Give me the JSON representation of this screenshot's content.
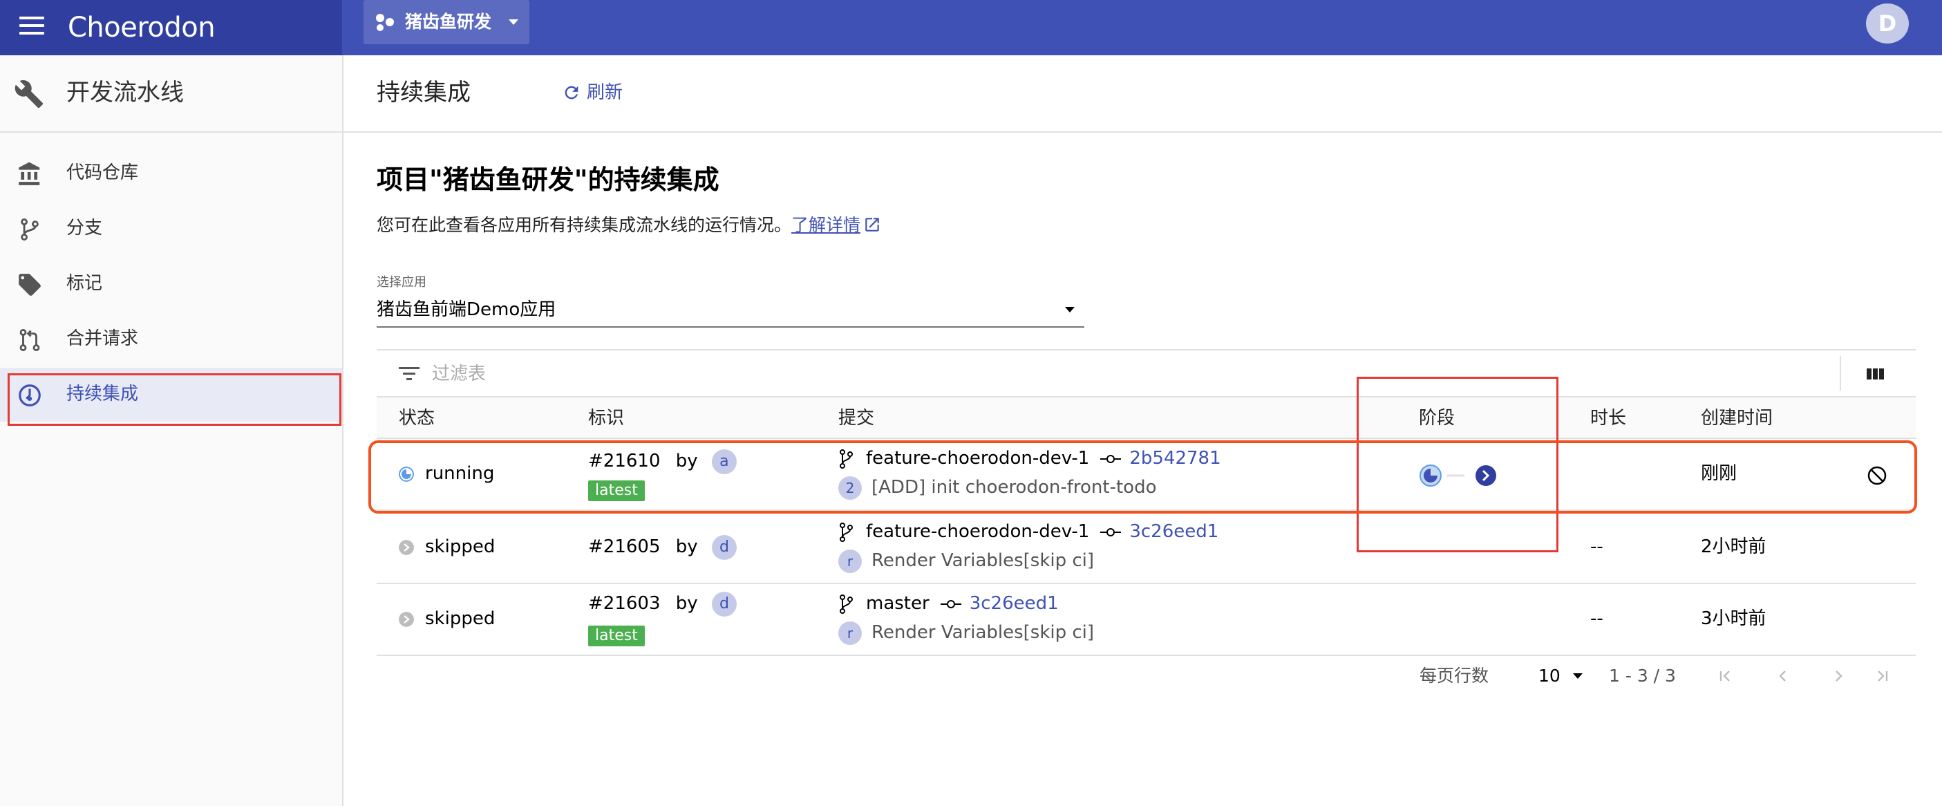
{
  "topbar": {
    "app_title": "Choerodon",
    "project_name": "猪齿鱼研发",
    "avatar_letter": "D",
    "bg_color": "#3f51b5"
  },
  "sidebar": {
    "title": "开发流水线",
    "items": [
      {
        "label": "代码仓库",
        "icon": "bank-icon"
      },
      {
        "label": "分支",
        "icon": "branch-icon"
      },
      {
        "label": "标记",
        "icon": "tag-icon"
      },
      {
        "label": "合并请求",
        "icon": "merge-request-icon"
      },
      {
        "label": "持续集成",
        "icon": "ci-icon",
        "active": true
      }
    ]
  },
  "header": {
    "title": "持续集成",
    "refresh_label": "刷新"
  },
  "content": {
    "heading": "项目\"猪齿鱼研发\"的持续集成",
    "description": "您可在此查看各应用所有持续集成流水线的运行情况。",
    "learn_more": "了解详情",
    "select_label": "选择应用",
    "select_value": "猪齿鱼前端Demo应用"
  },
  "table": {
    "filter_placeholder": "过滤表",
    "columns": [
      "状态",
      "标识",
      "提交",
      "阶段",
      "时长",
      "创建时间"
    ],
    "rows": [
      {
        "status": "running",
        "id": "#21610",
        "by": "by",
        "user_initial": "a",
        "latest": "latest",
        "branch": "feature-choerodon-dev-1",
        "sha": "2b542781",
        "commit_initial": "2",
        "commit_msg": "[ADD] init choerodon-front-todo",
        "duration": "",
        "created": "刚刚"
      },
      {
        "status": "skipped",
        "id": "#21605",
        "by": "by",
        "user_initial": "d",
        "latest": "",
        "branch": "feature-choerodon-dev-1",
        "sha": "3c26eed1",
        "commit_initial": "r",
        "commit_msg": "Render Variables[skip ci]",
        "duration": "--",
        "created": "2小时前"
      },
      {
        "status": "skipped",
        "id": "#21603",
        "by": "by",
        "user_initial": "d",
        "latest": "latest",
        "branch": "master",
        "sha": "3c26eed1",
        "commit_initial": "r",
        "commit_msg": "Render Variables[skip ci]",
        "duration": "--",
        "created": "3小时前"
      }
    ]
  },
  "pagination": {
    "rows_per_page_label": "每页行数",
    "rows_per_page": "10",
    "range": "1 - 3 / 3"
  },
  "colors": {
    "primary": "#3f51b5",
    "success": "#4caf50",
    "highlight_red": "#e53935",
    "highlight_orange": "#f4511e"
  }
}
